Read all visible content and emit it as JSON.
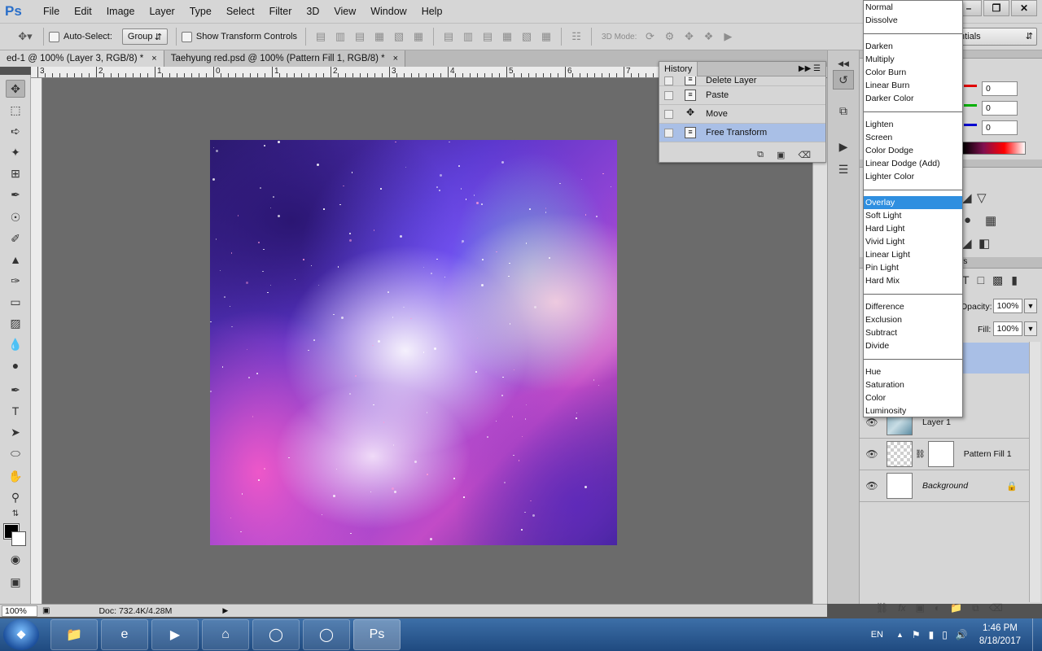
{
  "app": {
    "logo": "Ps"
  },
  "menu": [
    "File",
    "Edit",
    "Image",
    "Layer",
    "Type",
    "Select",
    "Filter",
    "3D",
    "View",
    "Window",
    "Help"
  ],
  "window_controls": {
    "minimize": "–",
    "restore": "❐",
    "close": "✕"
  },
  "options_bar": {
    "auto_select_label": "Auto-Select:",
    "auto_select_target": "Group",
    "show_transform_label": "Show Transform Controls",
    "mode_3d_label": "3D Mode:",
    "workspace_partial": "ntials"
  },
  "tabs": [
    {
      "label": "ed-1 @ 100% (Layer 3, RGB/8) *",
      "close": "×"
    },
    {
      "label": "Taehyung red.psd @ 100% (Pattern Fill 1, RGB/8) *",
      "close": "×"
    }
  ],
  "ruler_top": [
    "3",
    "2",
    "1",
    "0",
    "1",
    "2",
    "3",
    "4",
    "5",
    "6",
    "7"
  ],
  "history": {
    "title": "History",
    "items": [
      {
        "label": "Delete Layer",
        "icon": "document-icon",
        "selected": false
      },
      {
        "label": "Paste",
        "icon": "document-icon",
        "selected": false
      },
      {
        "label": "Move",
        "icon": "move-icon",
        "selected": false
      },
      {
        "label": "Free Transform",
        "icon": "document-icon",
        "selected": true
      }
    ]
  },
  "color_panel": {
    "r": "0",
    "g": "0",
    "b": "0",
    "r_color": "#e00000",
    "g_color": "#00b000",
    "b_color": "#0000d0"
  },
  "layers_panel": {
    "tab_partial": "rs",
    "opacity_label": "Opacity:",
    "opacity": "100%",
    "fill_label": "Fill:",
    "fill": "100%",
    "layers": [
      {
        "name": "Layer 1",
        "thumb": "image"
      },
      {
        "name": "Pattern Fill 1",
        "thumb": "pattern"
      },
      {
        "name": "Background",
        "thumb": "white"
      }
    ]
  },
  "blend_modes": [
    [
      "Normal",
      "Dissolve"
    ],
    [
      "Darken",
      "Multiply",
      "Color Burn",
      "Linear Burn",
      "Darker Color"
    ],
    [
      "Lighten",
      "Screen",
      "Color Dodge",
      "Linear Dodge (Add)",
      "Lighter Color"
    ],
    [
      "Overlay",
      "Soft Light",
      "Hard Light",
      "Vivid Light",
      "Linear Light",
      "Pin Light",
      "Hard Mix"
    ],
    [
      "Difference",
      "Exclusion",
      "Subtract",
      "Divide"
    ],
    [
      "Hue",
      "Saturation",
      "Color",
      "Luminosity"
    ]
  ],
  "blend_selected": "Overlay",
  "status": {
    "zoom": "100%",
    "doc": "Doc: 732.4K/4.28M"
  },
  "taskbar": {
    "apps": [
      "file-explorer",
      "internet-explorer",
      "media-player",
      "app-store",
      "chrome",
      "chrome",
      "photoshop"
    ],
    "language": "EN",
    "time": "1:46 PM",
    "date": "8/18/2017"
  }
}
